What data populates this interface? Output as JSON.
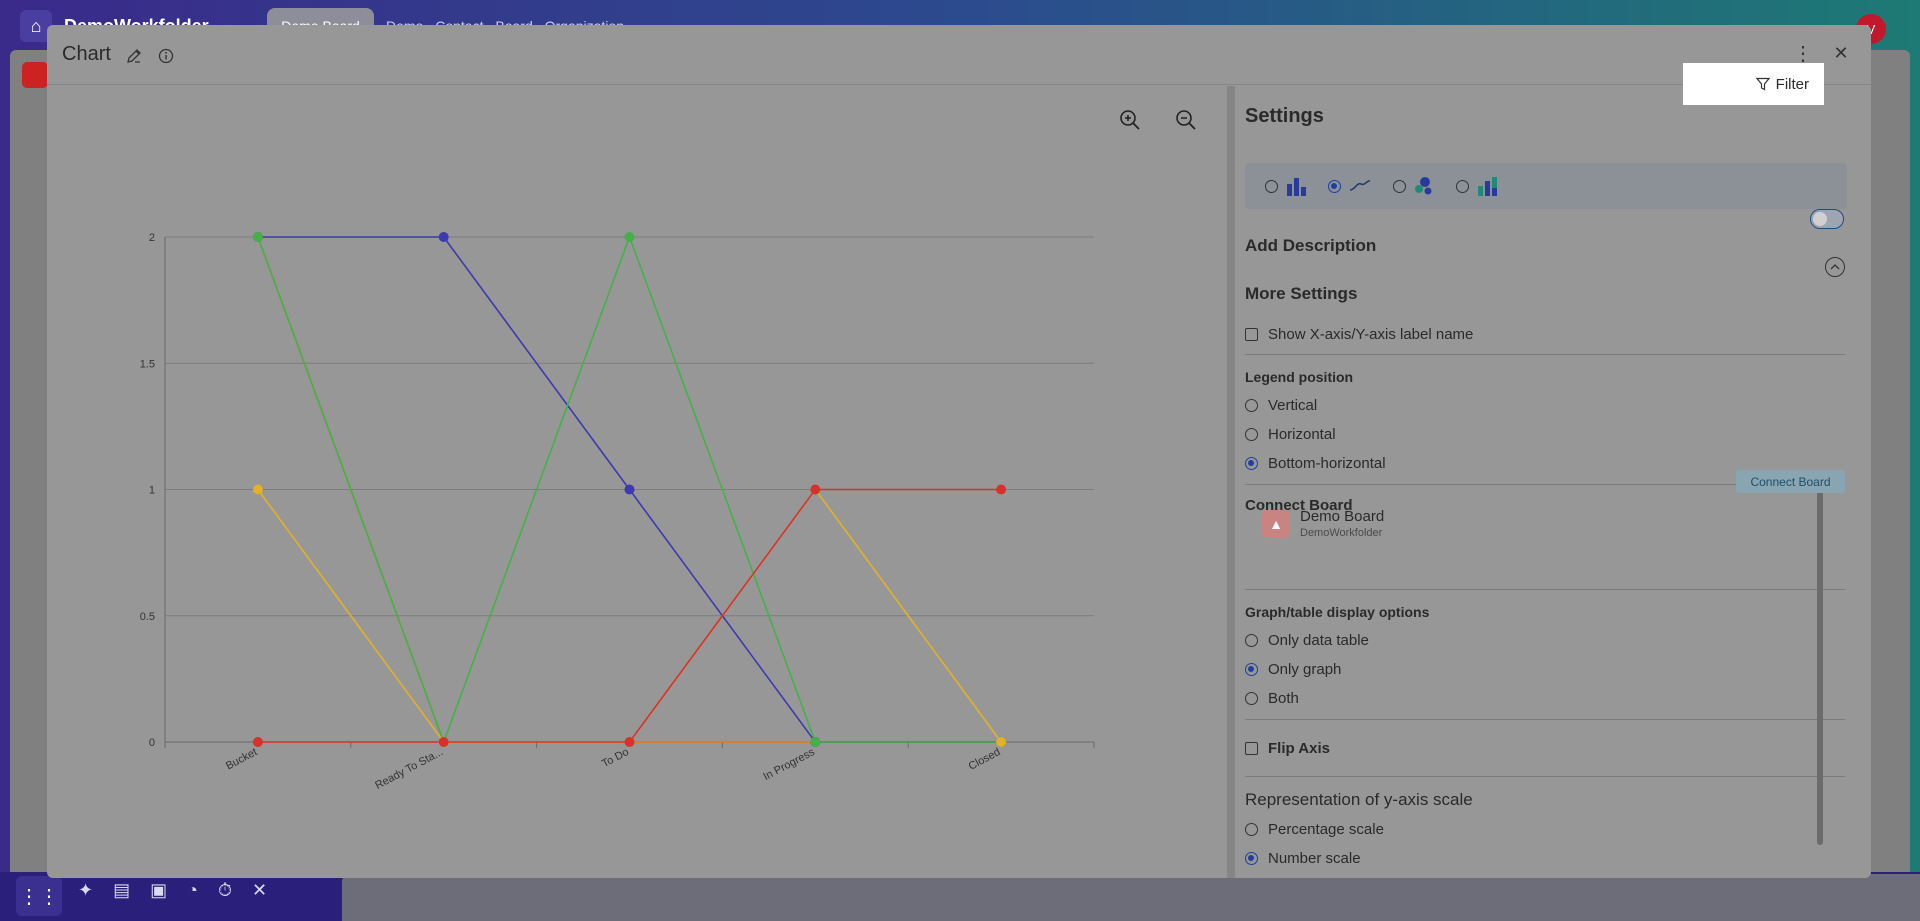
{
  "background": {
    "workspace_name": "DemoWorkfolder",
    "active_tab": "Demo Board",
    "other_tabs": "Demo Contact Board Organization",
    "avatar_initial": "V"
  },
  "modal": {
    "title": "Chart",
    "icons": {
      "edit": "pencil-icon",
      "info": "info-icon",
      "more": "more-vertical-icon",
      "close": "close-icon"
    }
  },
  "chart_data": {
    "type": "line",
    "categories": [
      "Bucket",
      "Ready To Sta...",
      "To Do",
      "In Progress",
      "Closed"
    ],
    "ylim": [
      0,
      2
    ],
    "yticks": [
      "0",
      "0.5",
      "1",
      "1.5",
      "2"
    ],
    "series": [
      {
        "color": "#e07b1a",
        "values": [
          2,
          0,
          0,
          0,
          0
        ]
      },
      {
        "color": "#3c3ab0",
        "values": [
          2,
          2,
          1,
          0,
          0
        ]
      },
      {
        "color": "#45b04a",
        "values": [
          2,
          0,
          2,
          0,
          0
        ]
      },
      {
        "color": "#e2b12a",
        "values": [
          1,
          0,
          0,
          1,
          0
        ]
      },
      {
        "color": "#d8302c",
        "values": [
          0,
          0,
          0,
          1,
          1
        ]
      }
    ]
  },
  "settings": {
    "title": "Settings",
    "filter_label": "Filter",
    "chart_types": [
      {
        "icon": "bar-chart-icon",
        "selected": false
      },
      {
        "icon": "line-chart-icon",
        "selected": true
      },
      {
        "icon": "bubble-chart-icon",
        "selected": false
      },
      {
        "icon": "stacked-bar-chart-icon",
        "selected": false
      }
    ],
    "add_description": "Add Description",
    "more_settings": "More Settings",
    "show_axis_label": "Show X-axis/Y-axis label name",
    "legend_position": {
      "title": "Legend position",
      "options": [
        "Vertical",
        "Horizontal",
        "Bottom-horizontal"
      ],
      "selected": "Bottom-horizontal"
    },
    "connect_board": {
      "title": "Connect Board",
      "button": "Connect Board",
      "board_name": "Demo Board",
      "board_folder": "DemoWorkfolder"
    },
    "display_options": {
      "title": "Graph/table display options",
      "options": [
        "Only data table",
        "Only graph",
        "Both"
      ],
      "selected": "Only graph"
    },
    "flip_axis": "Flip Axis",
    "y_scale": {
      "title": "Representation of y-axis scale",
      "options": [
        "Percentage scale",
        "Number scale"
      ],
      "selected": "Number scale"
    }
  }
}
